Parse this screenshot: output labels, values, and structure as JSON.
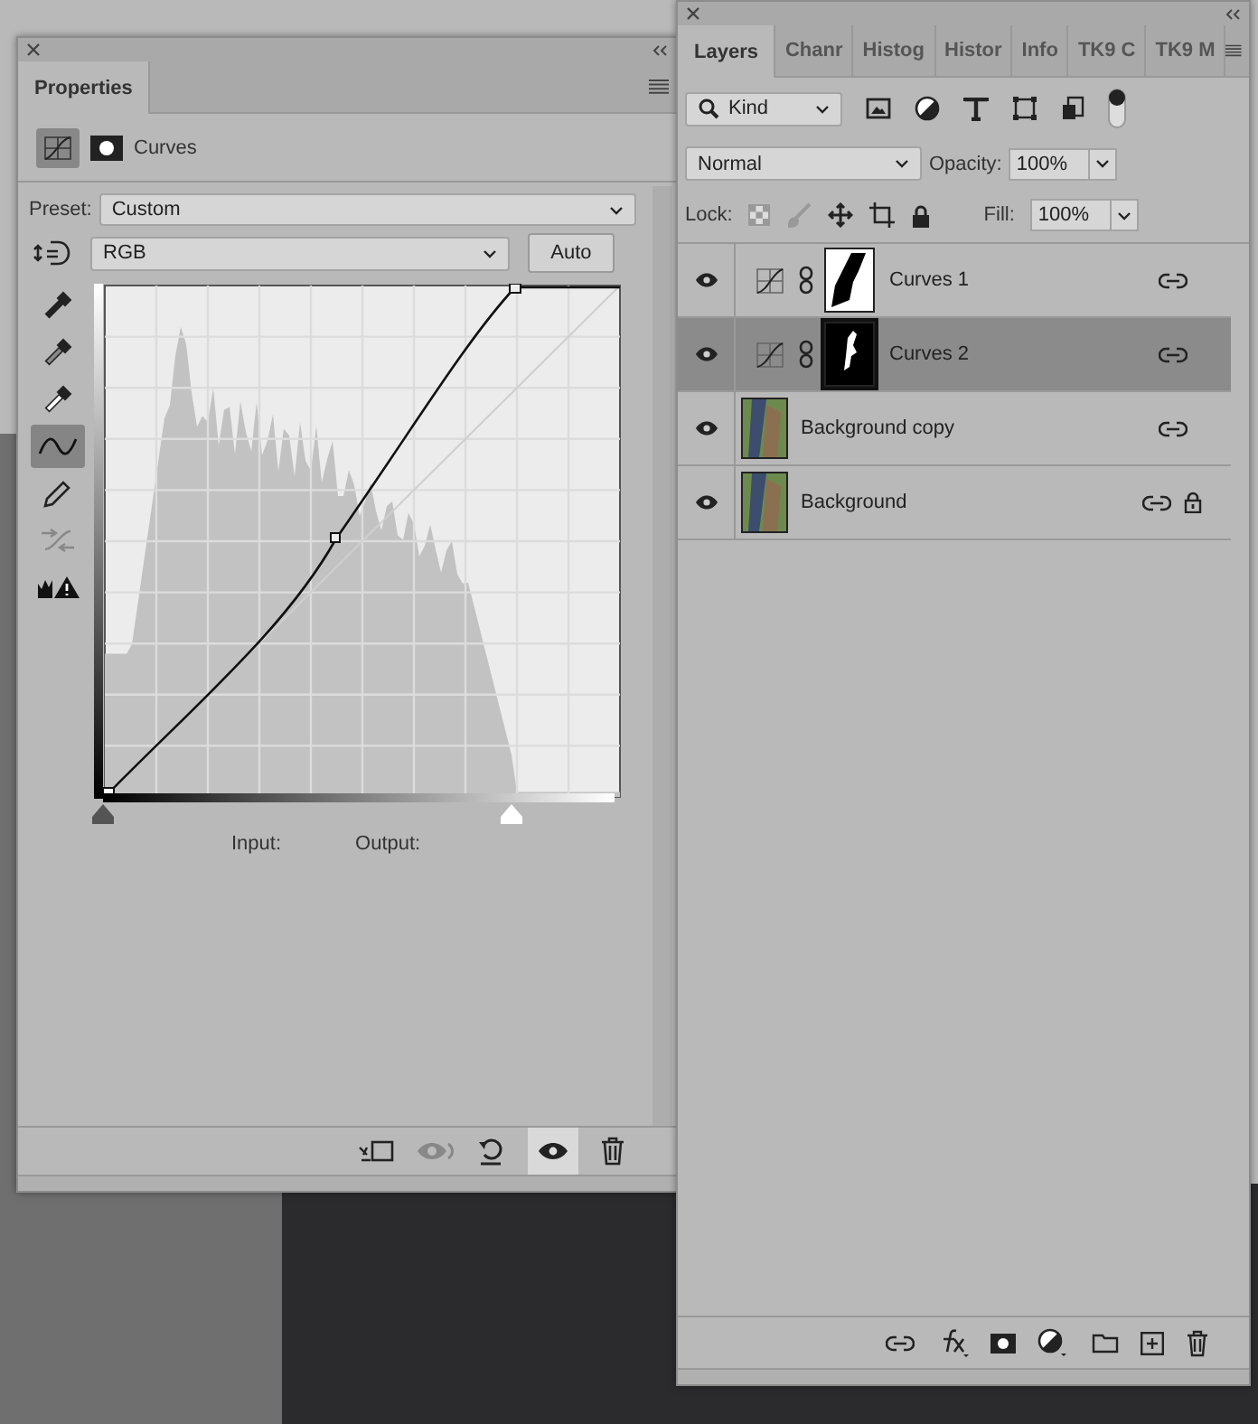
{
  "properties": {
    "tab": "Properties",
    "adjustment": "Curves",
    "preset_label": "Preset:",
    "preset": "Custom",
    "channel": "RGB",
    "auto_button": "Auto",
    "tools": [
      {
        "kind": "eyedropper-black",
        "selected": false
      },
      {
        "kind": "eyedropper-grey",
        "selected": false
      },
      {
        "kind": "eyedropper-white",
        "selected": false
      },
      {
        "kind": "curve",
        "selected": true
      },
      {
        "kind": "pencil",
        "selected": false
      },
      {
        "kind": "smooth",
        "selected": false
      },
      {
        "kind": "clipping",
        "selected": false
      }
    ],
    "input_sliders": [
      {
        "level": 0
      },
      {
        "level": 0.8
      }
    ],
    "input_label": "Input:",
    "output_label": "Output:"
  },
  "layers": {
    "tabs": [
      {
        "label": "Layers",
        "selected": true
      },
      {
        "label": "Chanr",
        "selected": false
      },
      {
        "label": "Histog",
        "selected": false
      },
      {
        "label": "Histor",
        "selected": false
      },
      {
        "label": "Info",
        "selected": false
      },
      {
        "label": "TK9 C",
        "selected": false
      },
      {
        "label": "TK9 M",
        "selected": false
      }
    ],
    "filter": "Kind",
    "blend_mode": "Normal",
    "opacity_label": "Opacity:",
    "opacity": "100%",
    "lock_label": "Lock:",
    "fill_label": "Fill:",
    "fill": "100%",
    "items": [
      {
        "kind": "adjustment",
        "name": "Curves 1",
        "selected": false,
        "locked": false
      },
      {
        "kind": "adjustment",
        "name": "Curves 2",
        "selected": true,
        "locked": false
      },
      {
        "kind": "image",
        "name": "Background copy",
        "selected": false,
        "locked": false
      },
      {
        "kind": "image",
        "name": "Background",
        "selected": false,
        "locked": true
      }
    ]
  }
}
